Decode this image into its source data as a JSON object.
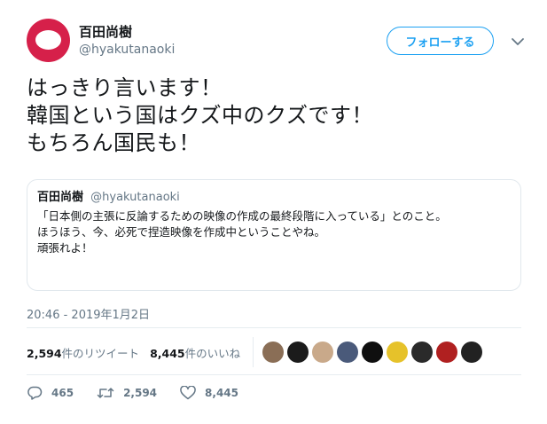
{
  "author": {
    "display_name": "百田尚樹",
    "handle": "@hyakutanaoki",
    "avatar_color": "#d6204a"
  },
  "follow_button": {
    "label": "フォローする",
    "color": "#1da1f2"
  },
  "tweet": {
    "lines": [
      "はっきり言います！",
      "韓国という国はクズ中のクズです！",
      "もちろん国民も！"
    ],
    "timestamp": "20:46 - 2019年1月2日"
  },
  "quoted_tweet": {
    "display_name": "百田尚樹",
    "handle": "@hyakutanaoki",
    "lines": [
      "「日本側の主張に反論するための映像の作成の最終段階に入っている」とのこと。",
      "ほうほう、今、必死で捏造映像を作成中ということやね。",
      "頑張れよ！"
    ]
  },
  "stats": {
    "retweets_count": "2,594",
    "retweets_label": "件のリツイート",
    "likes_count": "8,445",
    "likes_label": "件のいいね"
  },
  "liker_avatars": [
    "#8a6e56",
    "#1b1b1b",
    "#c9a98a",
    "#4a5a7a",
    "#0f0f0f",
    "#e6c22a",
    "#2a2a2a",
    "#b02020",
    "#222222"
  ],
  "actions": {
    "reply_count": "465",
    "retweet_count": "2,594",
    "like_count": "8,445"
  }
}
